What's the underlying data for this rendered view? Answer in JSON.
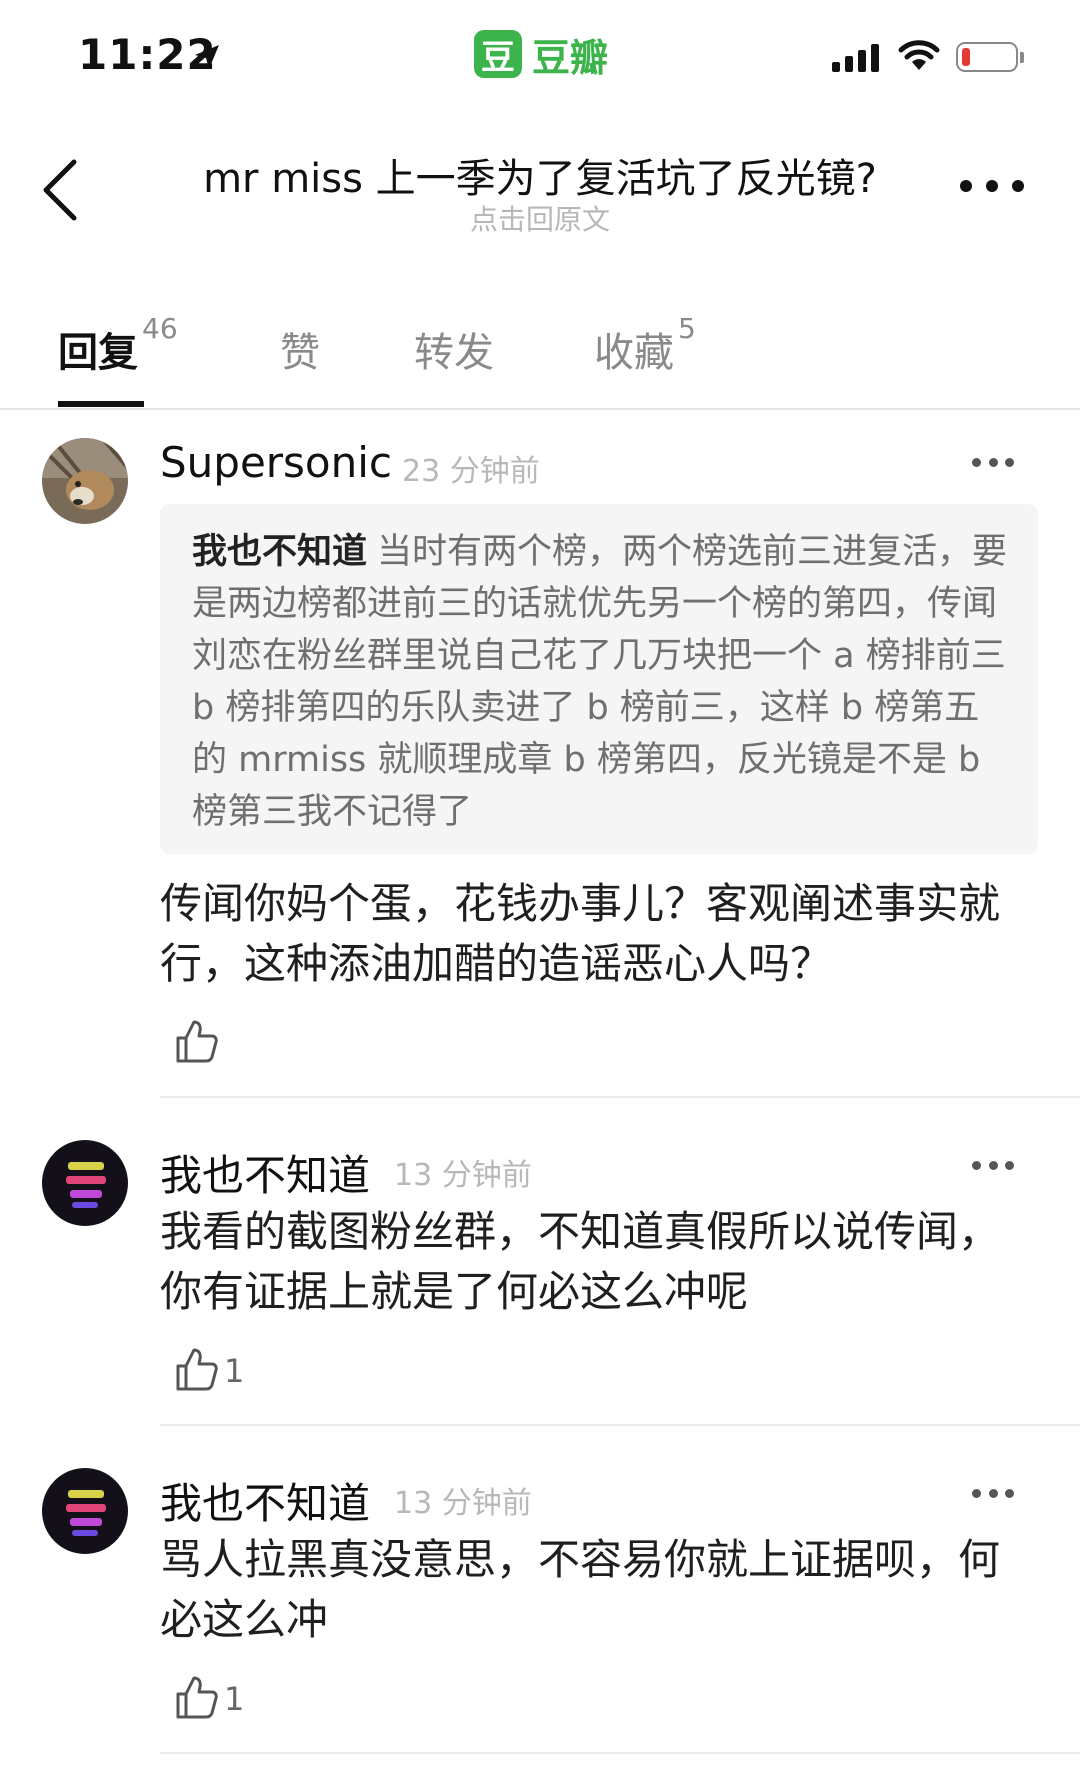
{
  "status_bar": {
    "time": "11:22",
    "app_badge": "豆",
    "app_name": "豆瓣",
    "battery_level": 0.15
  },
  "header": {
    "title": "mr miss 上一季为了复活坑了反光镜?",
    "subtitle": "点击回原文"
  },
  "tabs": [
    {
      "label": "回复",
      "count": "46",
      "active": true
    },
    {
      "label": "赞",
      "count": ""
    },
    {
      "label": "转发",
      "count": ""
    },
    {
      "label": "收藏",
      "count": "5"
    }
  ],
  "comments": [
    {
      "author": "Supersonic",
      "time": "23 分钟前",
      "quote_author": "我也不知道",
      "quote_text": "当时有两个榜，两个榜选前三进复活，要是两边榜都进前三的话就优先另一个榜的第四，传闻刘恋在粉丝群里说自己花了几万块把一个 a 榜排前三 b 榜排第四的乐队卖进了 b 榜前三，这样 b 榜第五的 mrmiss 就顺理成章 b 榜第四，反光镜是不是 b 榜第三我不记得了",
      "text": "传闻你妈个蛋，花钱办事儿？客观阐述事实就行，这种添油加醋的造谣恶心人吗？",
      "likes": ""
    },
    {
      "author": "我也不知道",
      "time": "13 分钟前",
      "text": "我看的截图粉丝群，不知道真假所以说传闻，你有证据上就是了何必这么冲呢",
      "likes": "1"
    },
    {
      "author": "我也不知道",
      "time": "13 分钟前",
      "text": "骂人拉黑真没意思，不容易你就上证据呗，何必这么冲",
      "likes": "1"
    }
  ]
}
